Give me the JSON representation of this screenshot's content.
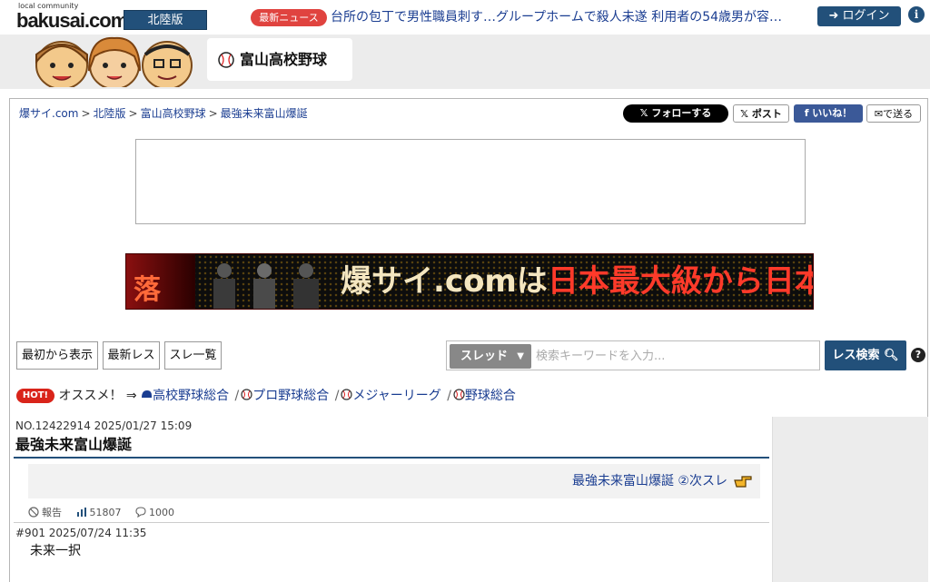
{
  "header": {
    "logo_small": "local community",
    "logo_main": "bakusai.com",
    "region": "北陸版",
    "news_label": "最新ニュース",
    "news_text": "台所の包丁で男性職員刺す…グループホームで殺人未遂 利用者の54歳男が容…",
    "login_label": "ログイン",
    "info_icon": "i"
  },
  "banner": {
    "board_title": "富山高校野球"
  },
  "breadcrumb": {
    "items": [
      "爆サイ.com",
      "北陸版",
      "富山高校野球",
      "最強未来富山爆誕"
    ],
    "separator": ">"
  },
  "sns": {
    "follow": "𝕏 フォローする",
    "post": "𝕏 ポスト",
    "like": "f いいね！",
    "send": "✉で送る"
  },
  "promo": {
    "left_char": "落",
    "slogan_white": "爆サイ.comは",
    "slogan_red": "日本最大級から日本最大"
  },
  "nav": {
    "from_start": "最初から表示",
    "latest": "最新レス",
    "thread_list": "スレ一覧"
  },
  "search": {
    "select_value": "スレッド",
    "placeholder": "検索キーワードを入力...",
    "button_label": "レス検索",
    "help": "?"
  },
  "recommend": {
    "hot": "HOT!",
    "lead": "オススメ！ ⇒",
    "links": [
      "高校野球総合",
      "プロ野球総合",
      "メジャーリーグ",
      "野球総合"
    ]
  },
  "thread": {
    "meta": "NO.12422914 2025/01/27 15:09",
    "title": "最強未来富山爆誕",
    "next_link": "最強未来富山爆誕 ②次スレ",
    "report": "報告",
    "views": "51807",
    "replies": "1000"
  },
  "post": {
    "meta": "#901 2025/07/24 11:35",
    "body": "未来一択"
  },
  "colors": {
    "brand_navy": "#22507a",
    "link_blue": "#1a3d91",
    "news_red": "#e0433f",
    "hot_red": "#d9241a"
  }
}
